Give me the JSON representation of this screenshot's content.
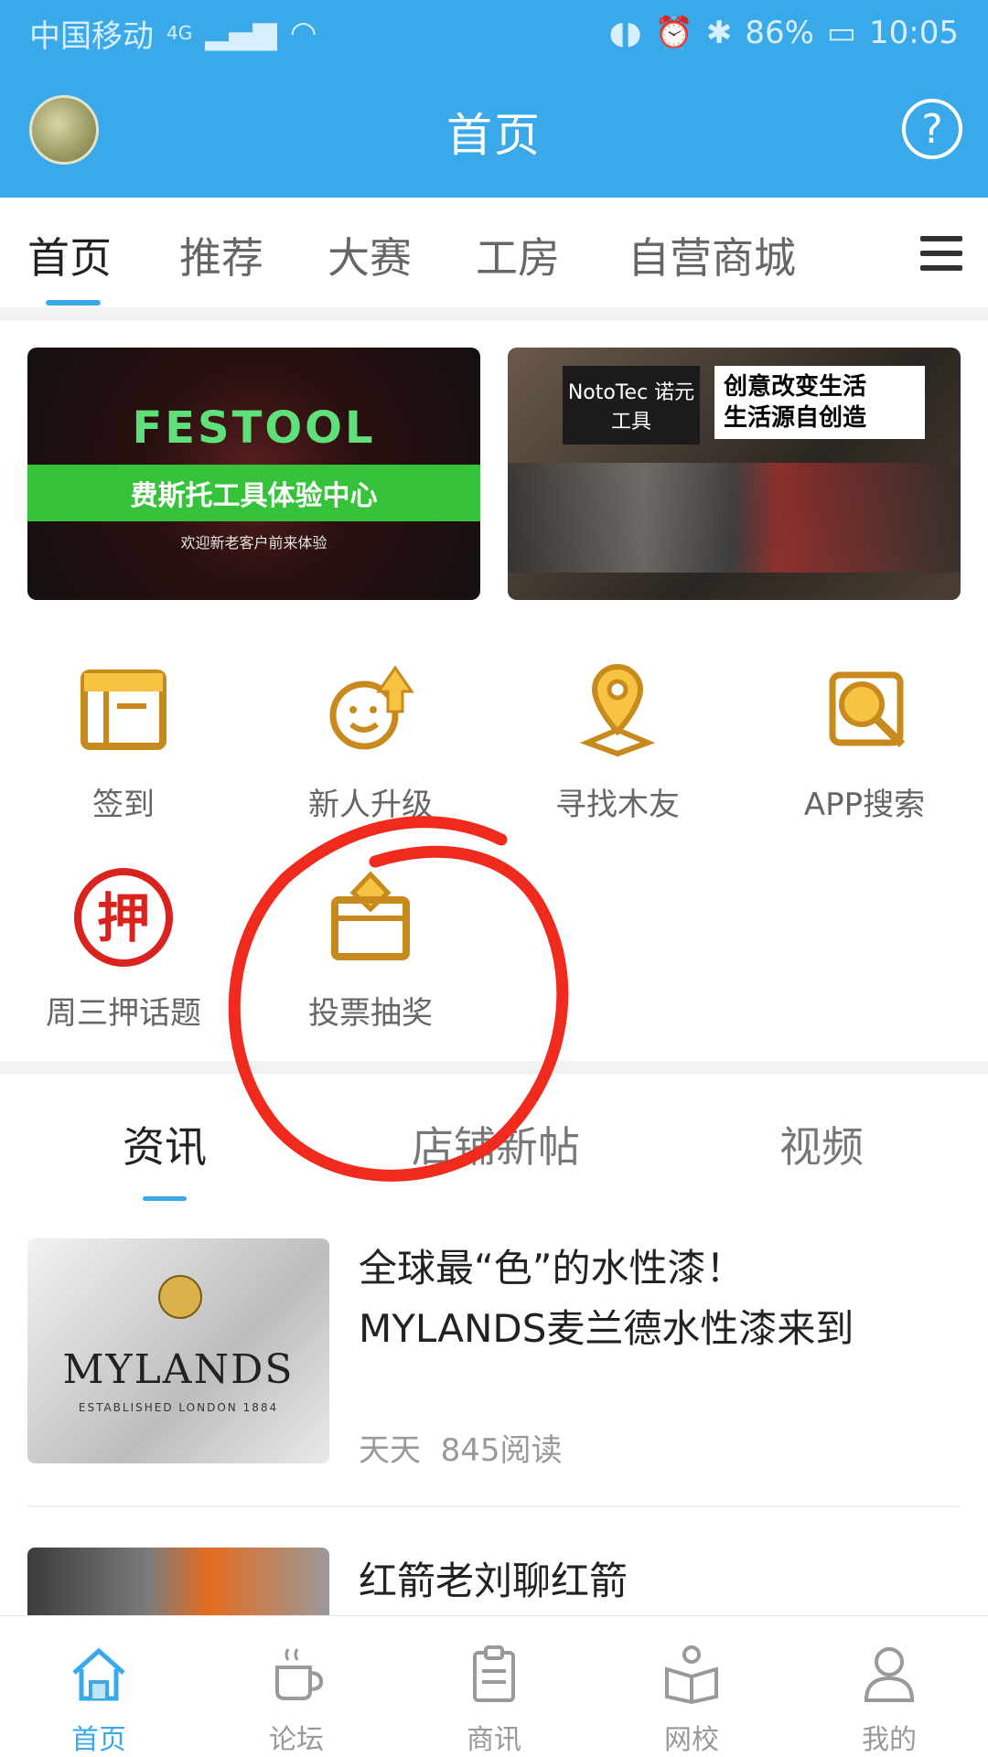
{
  "status_bar": {
    "carrier": "中国移动",
    "network": "4G",
    "battery": "86%",
    "time": "10:05"
  },
  "app_bar": {
    "title": "首页"
  },
  "tabs": [
    "首页",
    "推荐",
    "大赛",
    "工房",
    "自营商城"
  ],
  "banners": [
    {
      "brand": "FESTOOL",
      "subtitle": "费斯托工具体验中心",
      "caption": "欢迎新老客户前来体验"
    },
    {
      "logo": "NotoTec 诺元工具",
      "slogan_1": "创意改变生活",
      "slogan_2": "生活源自创造"
    }
  ],
  "quick_actions": [
    {
      "label": "签到",
      "icon": "calendar-icon"
    },
    {
      "label": "新人升级",
      "icon": "smiley-upgrade-icon"
    },
    {
      "label": "寻找木友",
      "icon": "location-pin-icon"
    },
    {
      "label": "APP搜索",
      "icon": "search-icon"
    },
    {
      "label": "周三押话题",
      "icon": "ya-seal-icon",
      "glyph": "押"
    },
    {
      "label": "投票抽奖",
      "icon": "ballot-box-icon"
    }
  ],
  "feed_tabs": [
    "资讯",
    "店铺新帖",
    "视频"
  ],
  "articles": [
    {
      "title_line1": "全球最“色”的水性漆！",
      "title_line2": "MYLANDS麦兰德水性漆来到",
      "author": "天天",
      "reads": "845阅读",
      "thumb_brand": "MYLANDS",
      "thumb_est": "ESTABLISHED LONDON 1884"
    },
    {
      "title_line1": "红箭老刘聊红箭"
    }
  ],
  "bottom_nav": [
    "首页",
    "论坛",
    "商讯",
    "网校",
    "我的"
  ],
  "colors": {
    "primary": "#3aa9ea",
    "icon_gold": "#c98a1d",
    "annotation_red": "#f02a1d"
  }
}
